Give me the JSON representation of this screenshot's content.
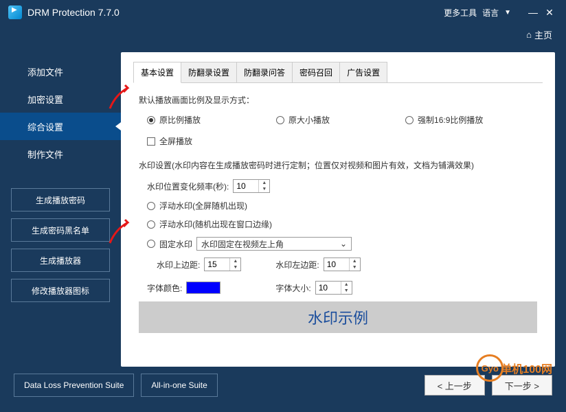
{
  "titlebar": {
    "title": "DRM Protection 7.7.0",
    "more_tools": "更多工具",
    "language": "语言"
  },
  "homebar": {
    "home": "主页"
  },
  "sidebar": {
    "items": [
      {
        "label": "添加文件"
      },
      {
        "label": "加密设置"
      },
      {
        "label": "综合设置"
      },
      {
        "label": "制作文件"
      }
    ],
    "buttons": [
      {
        "label": "生成播放密码"
      },
      {
        "label": "生成密码黑名单"
      },
      {
        "label": "生成播放器"
      },
      {
        "label": "修改播放器图标"
      }
    ]
  },
  "tabs": [
    {
      "label": "基本设置"
    },
    {
      "label": "防翻录设置"
    },
    {
      "label": "防翻录问答"
    },
    {
      "label": "密码召回"
    },
    {
      "label": "广告设置"
    }
  ],
  "panel": {
    "display_mode_label": "默认播放画面比例及显示方式：",
    "ratio_opts": [
      {
        "label": "原比例播放"
      },
      {
        "label": "原大小播放"
      },
      {
        "label": "强制16:9比例播放"
      }
    ],
    "fullscreen": "全屏播放",
    "watermark_label": "水印设置(水印内容在生成播放密码时进行定制；位置仅对视频和图片有效，文档为铺满效果)",
    "freq_label": "水印位置变化频率(秒):",
    "freq_value": "10",
    "float_full": "浮动水印(全屏随机出现)",
    "float_edge": "浮动水印(随机出现在窗口边缘)",
    "fixed": "固定水印",
    "fixed_select": "水印固定在视频左上角",
    "top_margin": "水印上边距:",
    "top_value": "15",
    "left_margin": "水印左边距:",
    "left_value": "10",
    "font_color": "字体颜色:",
    "font_size": "字体大小:",
    "font_size_value": "10",
    "preview": "水印示例"
  },
  "footer": {
    "dlp": "Data Loss Prevention Suite",
    "aio": "All-in-one Suite",
    "prev": "< 上一步",
    "next": "下一步 >"
  },
  "branding": {
    "text": "单机100网"
  }
}
